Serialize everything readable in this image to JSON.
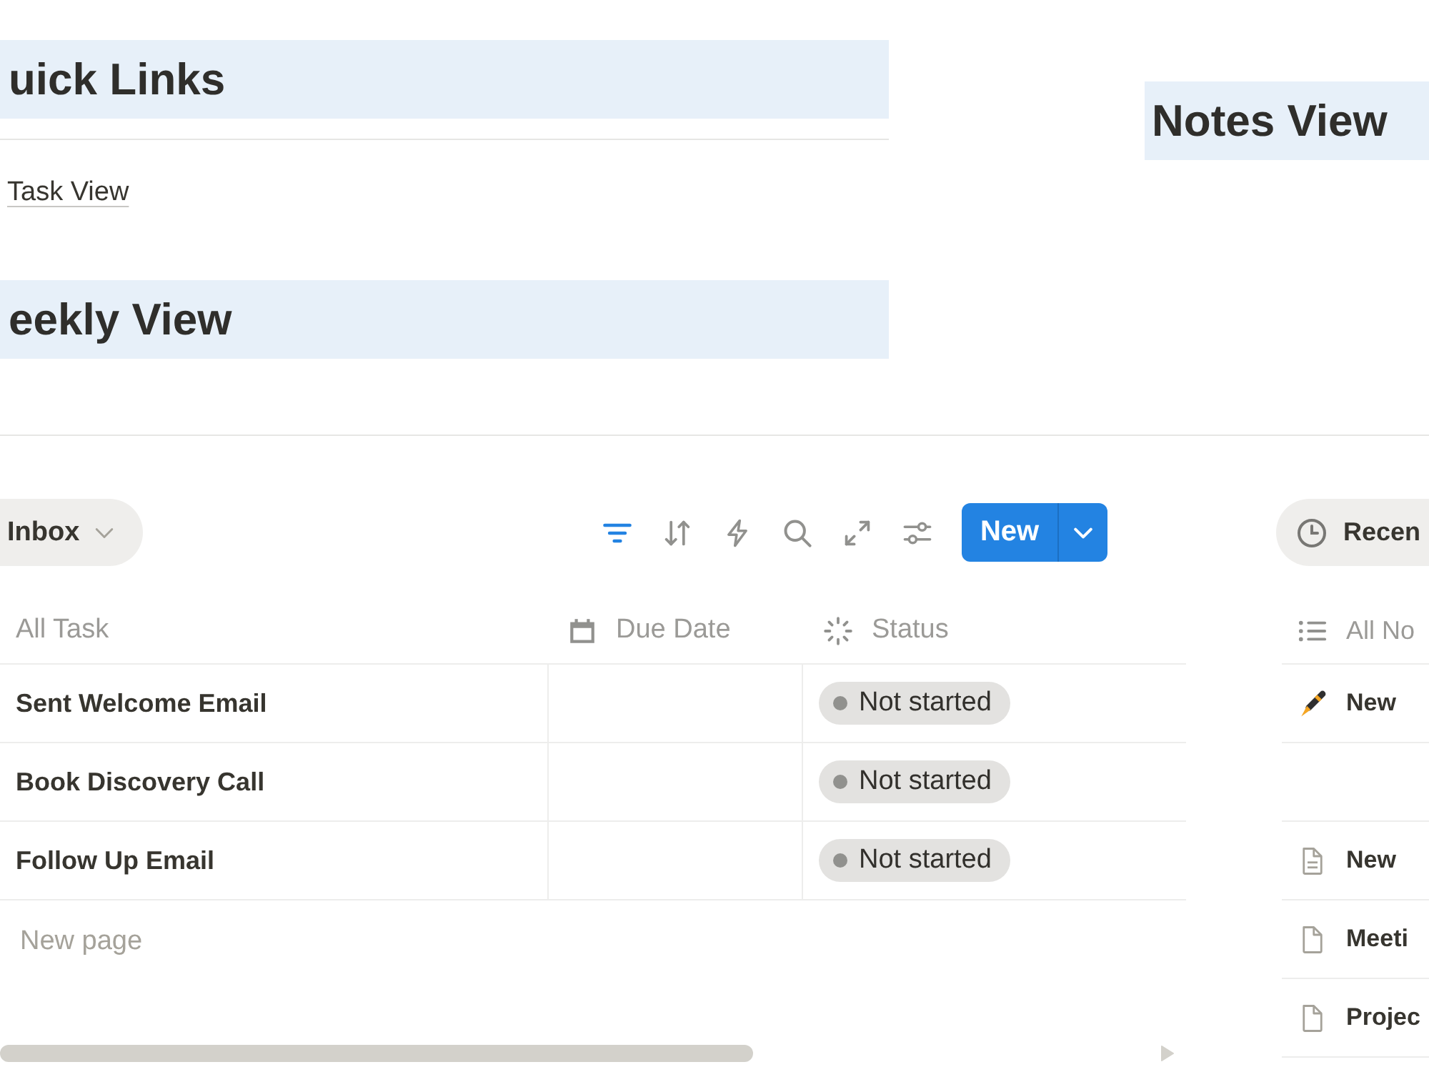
{
  "quick_links": {
    "heading": "uick Links",
    "links": [
      {
        "label": "Task View"
      }
    ]
  },
  "weekly_view": {
    "heading": "eekly View",
    "view_tab": {
      "label": "Inbox"
    },
    "toolbar": {
      "filter_active": true,
      "new_button": "New"
    },
    "table": {
      "columns": [
        {
          "label": "All Task",
          "kind": "title"
        },
        {
          "label": "Due Date",
          "kind": "date"
        },
        {
          "label": "Status",
          "kind": "status"
        }
      ],
      "rows": [
        {
          "title": "Sent Welcome Email",
          "status": {
            "label": "Not started",
            "color": "#91918e"
          }
        },
        {
          "title": "Book Discovery Call",
          "status": {
            "label": "Not started",
            "color": "#91918e"
          }
        },
        {
          "title": "Follow Up Email",
          "status": {
            "label": "Not started",
            "color": "#91918e"
          }
        }
      ],
      "new_row": "New page"
    }
  },
  "notes_view": {
    "heading": "Notes View",
    "view_tab": {
      "label": "Recen"
    },
    "list": {
      "column": "All No",
      "items": [
        {
          "kind": "pen",
          "title": "New"
        },
        {
          "kind": "blank"
        },
        {
          "kind": "page_text",
          "title": "New"
        },
        {
          "kind": "page",
          "title": "Meeti"
        },
        {
          "kind": "page",
          "title": "Projec"
        }
      ]
    }
  }
}
